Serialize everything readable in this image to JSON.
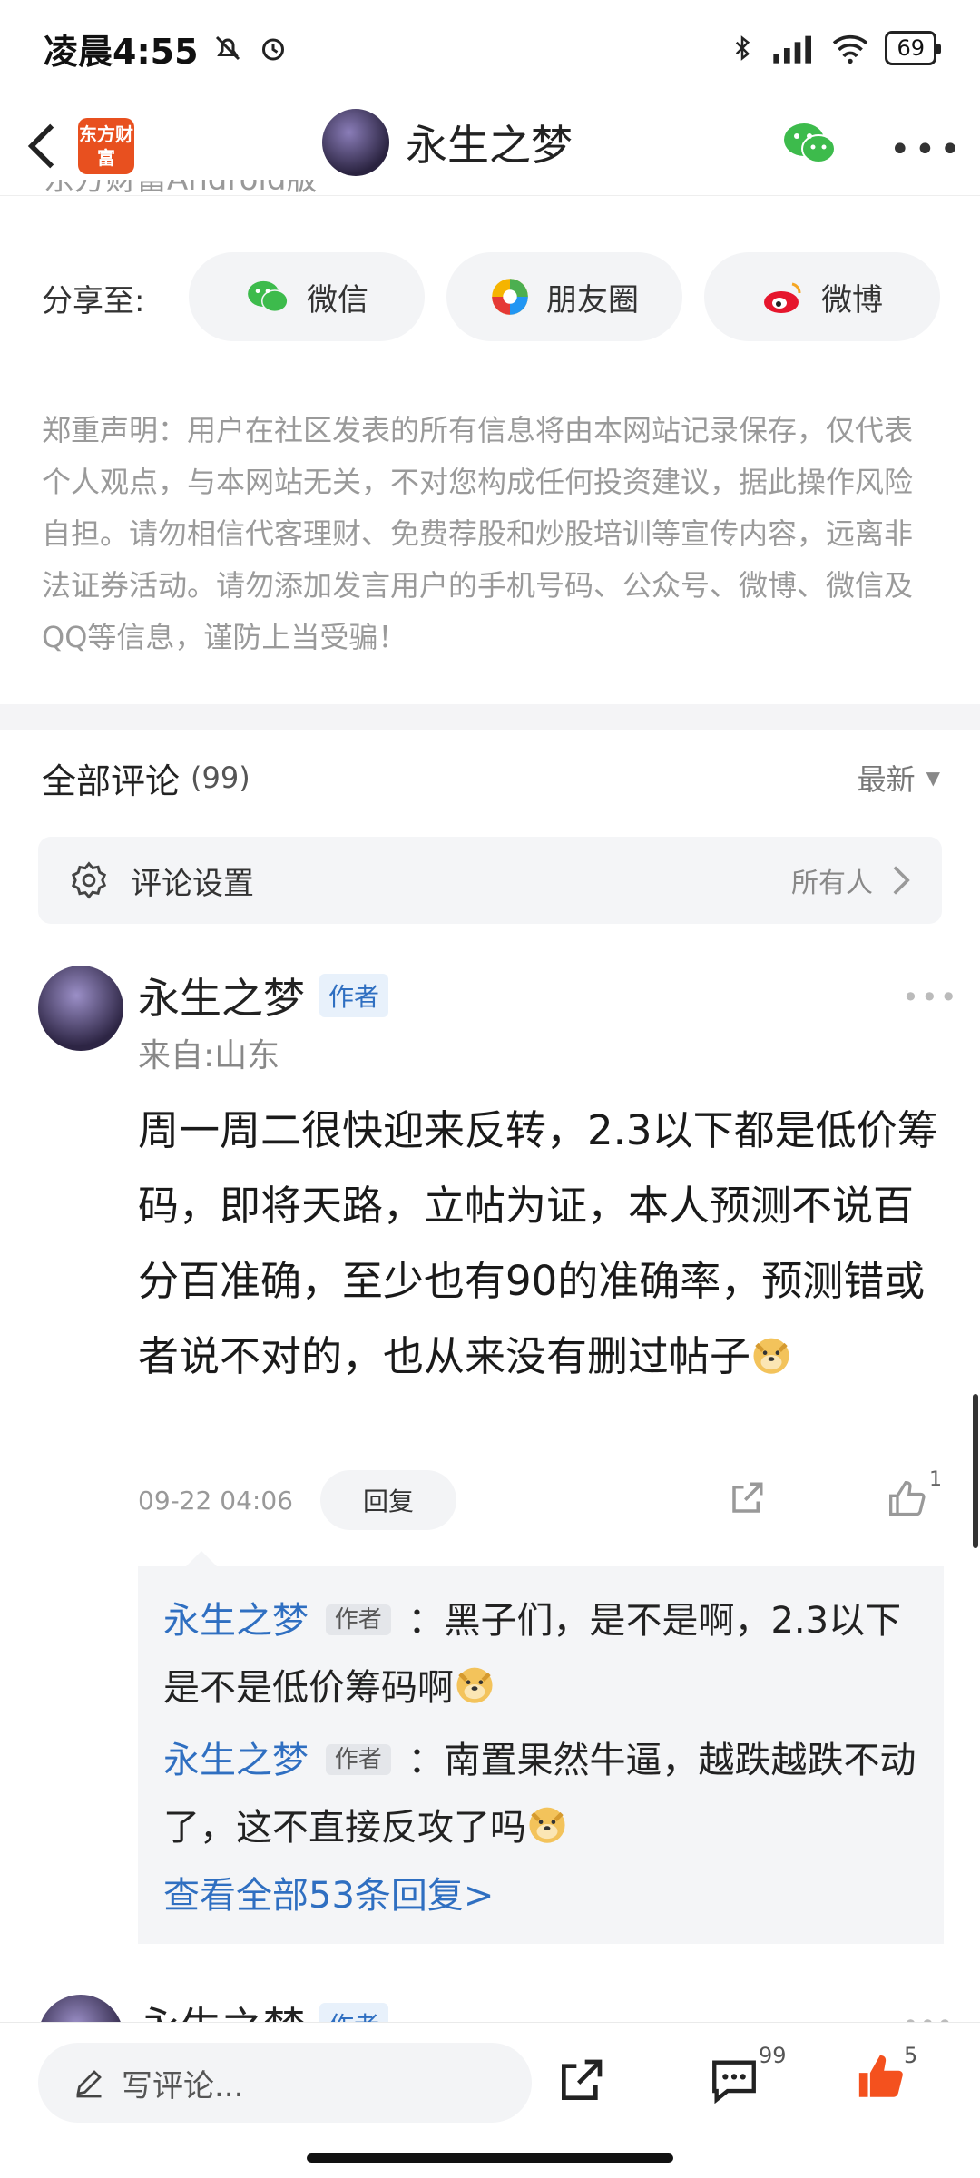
{
  "status_bar": {
    "time": "凌晨4:55",
    "battery": "69"
  },
  "header": {
    "app_logo_text": "东方财富",
    "title": "永生之梦"
  },
  "clipped_text": "东方财富Android版",
  "share": {
    "label": "分享至:",
    "wechat": "微信",
    "moments": "朋友圈",
    "weibo": "微博"
  },
  "disclaimer": "郑重声明：用户在社区发表的所有信息将由本网站记录保存，仅代表个人观点，与本网站无关，不对您构成任何投资建议，据此操作风险自担。请勿相信代客理财、免费荐股和炒股培训等宣传内容，远离非法证券活动。请勿添加发言用户的手机号码、公众号、微博、微信及QQ等信息，谨防上当受骗！",
  "comments": {
    "title": "全部评论",
    "count": "(99)",
    "sort": "最新",
    "settings_label": "评论设置",
    "settings_value": "所有人"
  },
  "comment": {
    "author": "永生之梦",
    "badge": "作者",
    "location": "来自:山东",
    "body": "周一周二很快迎来反转，2.3以下都是低价筹码，即将天路，立帖为证，本人预测不说百分百准确，至少也有90的准确率，预测错或者说不对的，也从来没有删过帖子",
    "time": "09-22 04:06",
    "reply_label": "回复",
    "likes": "1"
  },
  "replies": [
    {
      "author": "永生之梦",
      "badge": "作者",
      "text": "：黑子们，是不是啊，2.3以下是不是低价筹码啊"
    },
    {
      "author": "永生之梦",
      "badge": "作者",
      "text": "：南置果然牛逼，越跌越跌不动了，这不直接反攻了吗"
    }
  ],
  "view_all": "查看全部53条回复>",
  "next_comment": {
    "author": "永生之梦",
    "badge": "作者"
  },
  "bottom_bar": {
    "write_placeholder": "写评论...",
    "comment_count": "99",
    "like_count": "5"
  }
}
